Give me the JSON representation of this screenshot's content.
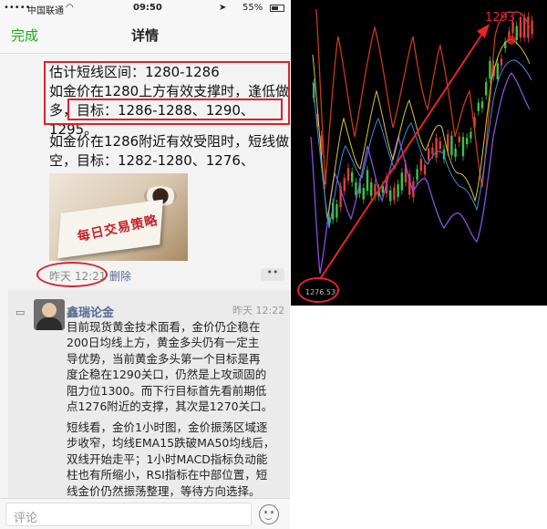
{
  "status_bar": {
    "carrier": "中国联通",
    "time": "09:50",
    "battery": "55%"
  },
  "nav": {
    "done": "完成",
    "title": "详情"
  },
  "post": {
    "lines": [
      "估计短线区间：1280-1286",
      "如金价在1280上方有效支撑时，逢低做",
      "多，目标：1286-1288、1290、1295。"
    ],
    "lines2": [
      "如金价在1286附近有效受阻时，短线做",
      "空，目标：1282-1280、1276、1270。"
    ],
    "image_title": "每日交易策略",
    "time": "昨天 12:21",
    "delete": "删除",
    "more": "••"
  },
  "comment": {
    "author": "鑫瑞论金",
    "time": "昨天 12:22",
    "para1": [
      "目前现货黄金技术面看，金价仍企稳在",
      "200日均线上方，黄金多头仍有一定主",
      "导优势，当前黄金多头第一个目标是再",
      "度企稳在1290关口，仍然是上攻顽固的",
      "阻力位1300。而下行目标首先看前期低",
      "点1276附近的支撑，其次是1270关口。"
    ],
    "para2": [
      "短线看，金价1小时图，金价振荡区域逐",
      "步收窄，均线EMA15跌破MA50均线后，",
      "双线开始走平；1小时MACD指标负动能",
      "柱也有所缩小，RSI指标在中部位置，短",
      "线金价仍然振荡整理，等待方向选择。"
    ]
  },
  "input": {
    "placeholder": "评论"
  },
  "chart": {
    "low_label": "1276.53",
    "high_label": "1293"
  },
  "colors": {
    "accent": "#1aad19",
    "annotation_red": "#d6242a",
    "link_blue": "#576b95"
  }
}
